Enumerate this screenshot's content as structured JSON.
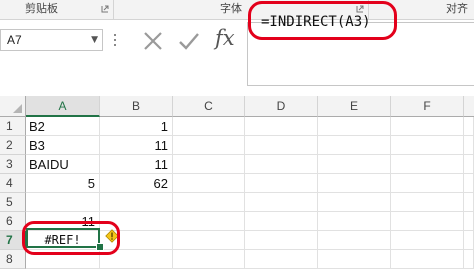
{
  "ribbon": {
    "groups": [
      {
        "label": "剪贴板"
      },
      {
        "label": "字体"
      },
      {
        "label": "对齐"
      }
    ]
  },
  "formula_bar": {
    "name_box": "A7",
    "formula": "=INDIRECT(A3)",
    "fx_label": "fx"
  },
  "grid": {
    "columns": [
      "A",
      "B",
      "C",
      "D",
      "E",
      "F"
    ],
    "rows": [
      "1",
      "2",
      "3",
      "4",
      "5",
      "6",
      "7",
      "8"
    ],
    "active_column": "A",
    "active_row": "7",
    "cells": {
      "A1": "B2",
      "B1": "1",
      "A2": "B3",
      "B2": "11",
      "A3": "BAIDU",
      "B3": "11",
      "A4": "5",
      "B4": "62",
      "A6": "11",
      "A7": "#REF!"
    }
  },
  "colors": {
    "accent": "#217346",
    "highlight": "#e3001b",
    "warning": "#f5c518"
  }
}
